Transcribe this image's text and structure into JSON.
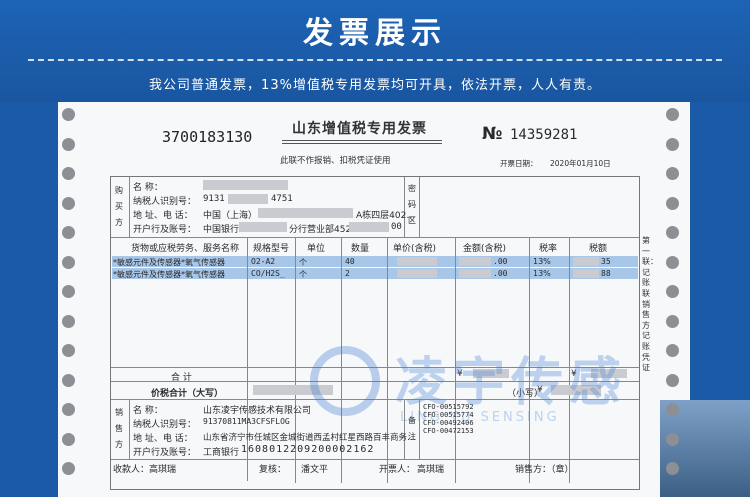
{
  "header": {
    "title": "发票展示",
    "subtitle": "我公司普通发票，13%增值税专用发票均可开具，依法开票，人人有责。"
  },
  "invoice": {
    "code": "3700183130",
    "title": "山东增值税专用发票",
    "number_mark": "№",
    "number": "14359281",
    "notice": "此联不作报销、扣税凭证使用",
    "date_label": "开票日期：",
    "date": "2020年01月10日",
    "buyer": {
      "side_label": "购买方",
      "name_label": "名    称：",
      "tax_id_label": "纳税人识别号：",
      "tax_id_partial": "9131",
      "tax_id_tail": "4751",
      "address_label": "地 址、电 话：",
      "address_partial": "中国（上海）",
      "address_tail": "A栋四层402…",
      "bank_label": "开户行及账号：",
      "bank_partial": "中国银行",
      "bank_mid": "分行营业部452",
      "bank_tail": "00"
    },
    "cipher_label": "密码区",
    "table": {
      "headers": [
        "货物或应税劳务、服务名称",
        "规格型号",
        "单位",
        "数量",
        "单价(含税)",
        "金额(含税)",
        "税率",
        "税额"
      ],
      "rows": [
        {
          "name": "*敏感元件及传感器*氧气传感器",
          "model": "O2-A2",
          "unit": "个",
          "qty": "40",
          "amount": ".00",
          "rate": "13%",
          "tax": "35"
        },
        {
          "name": "*敏感元件及传感器*氧气传感器",
          "model": "CO/H2S_",
          "unit": "个",
          "qty": "2",
          "amount": ".00",
          "rate": "13%",
          "tax": "88"
        }
      ]
    },
    "total_label": "合    计",
    "total_symbol_1": "¥",
    "total_symbol_2": "¥",
    "price_total_label": "价税合计（大写）",
    "lower_label": "（小写）",
    "lower_symbol": "¥",
    "seller": {
      "side_label": "销售方",
      "name_label": "名    称：",
      "name": "山东凌宇传感技术有限公司",
      "tax_id_label": "纳税人识别号：",
      "tax_id": "91370811MA3CFSFLOG",
      "address_label": "地 址、电 话：",
      "address": "山东省济宁市任城区金城街道西孟村红星西路百丰商务…",
      "bank_label": "开户行及账号：",
      "bank": "工商银行",
      "account": "1608012209200002162"
    },
    "remarks_label": "备注",
    "remarks": [
      "CFO-00515792",
      "CFO-00515774",
      "CFO-00492406",
      "CFO-00472153"
    ],
    "footer": {
      "payee_label": "收款人：",
      "payee": "高琪瑞",
      "reviewer_label": "复核：",
      "reviewer": "潘文平",
      "issuer_label": "开票人：",
      "issuer": "高琪瑞",
      "seller_seal_label": "销售方：（章）"
    },
    "copy_note": "第一联：记账联 销售方记账凭证"
  },
  "watermark": {
    "cn": "凌宇传感",
    "en": "LING YU SENSING"
  },
  "colors": {
    "header_bg": "#1d63b5",
    "row_highlight": "#a8c6e8",
    "watermark": "#4f8ad6"
  }
}
